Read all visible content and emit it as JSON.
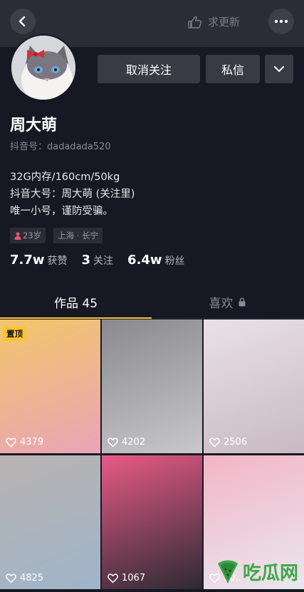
{
  "topbar": {
    "update_label": "求更新"
  },
  "profile": {
    "buttons": {
      "unfollow": "取消关注",
      "message": "私信"
    },
    "name": "周大萌",
    "douyin_id": "抖音号：dadadada520",
    "bio": [
      "32G内存/160cm/50kg",
      "抖音大号：周大萌 (关注里)",
      "唯一小号，谨防受骗。"
    ],
    "tags": {
      "age": "23岁",
      "location": "上海 · 长宁"
    },
    "stats": {
      "likes_num": "7.7w",
      "likes_label": "获赞",
      "following_num": "3",
      "following_label": "关注",
      "followers_num": "6.4w",
      "followers_label": "粉丝"
    }
  },
  "tabs": {
    "works": "作品 45",
    "likes": "喜欢"
  },
  "videos": [
    {
      "likes": "4379",
      "pinned_label": "置顶",
      "colors": [
        "#f2c66a",
        "#e9a4b8"
      ]
    },
    {
      "likes": "4202",
      "colors": [
        "#8a8a8e",
        "#c8c8cc"
      ]
    },
    {
      "likes": "2506",
      "colors": [
        "#e8e2e6",
        "#c9b9c2"
      ]
    },
    {
      "likes": "4825",
      "colors": [
        "#b9b3b1",
        "#9fb4c9"
      ]
    },
    {
      "likes": "1067",
      "colors": [
        "#e85a86",
        "#2c2a33"
      ]
    },
    {
      "likes": "10..",
      "colors": [
        "#f3b5c7",
        "#e9e7ee"
      ]
    }
  ],
  "watermark": {
    "text": "吃瓜网"
  },
  "colors": {
    "background": "#161823",
    "accent": "#fcc42d",
    "button": "#393b44"
  }
}
